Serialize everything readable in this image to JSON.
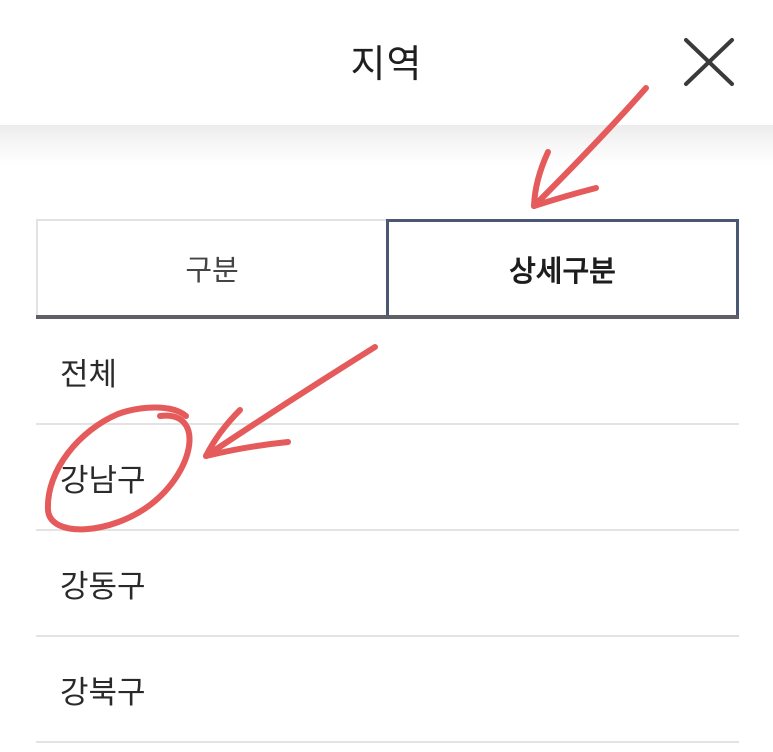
{
  "header": {
    "title": "지역",
    "close_icon": "close-icon"
  },
  "tabs": [
    {
      "label": "구분",
      "active": false
    },
    {
      "label": "상세구분",
      "active": true
    }
  ],
  "list": {
    "items": [
      {
        "label": "전체"
      },
      {
        "label": "강남구"
      },
      {
        "label": "강동구"
      },
      {
        "label": "강북구"
      }
    ]
  },
  "colors": {
    "active_tab_border": "#4a5874",
    "tab_underline": "#5f6067",
    "annotation_red": "#e55a5a"
  }
}
